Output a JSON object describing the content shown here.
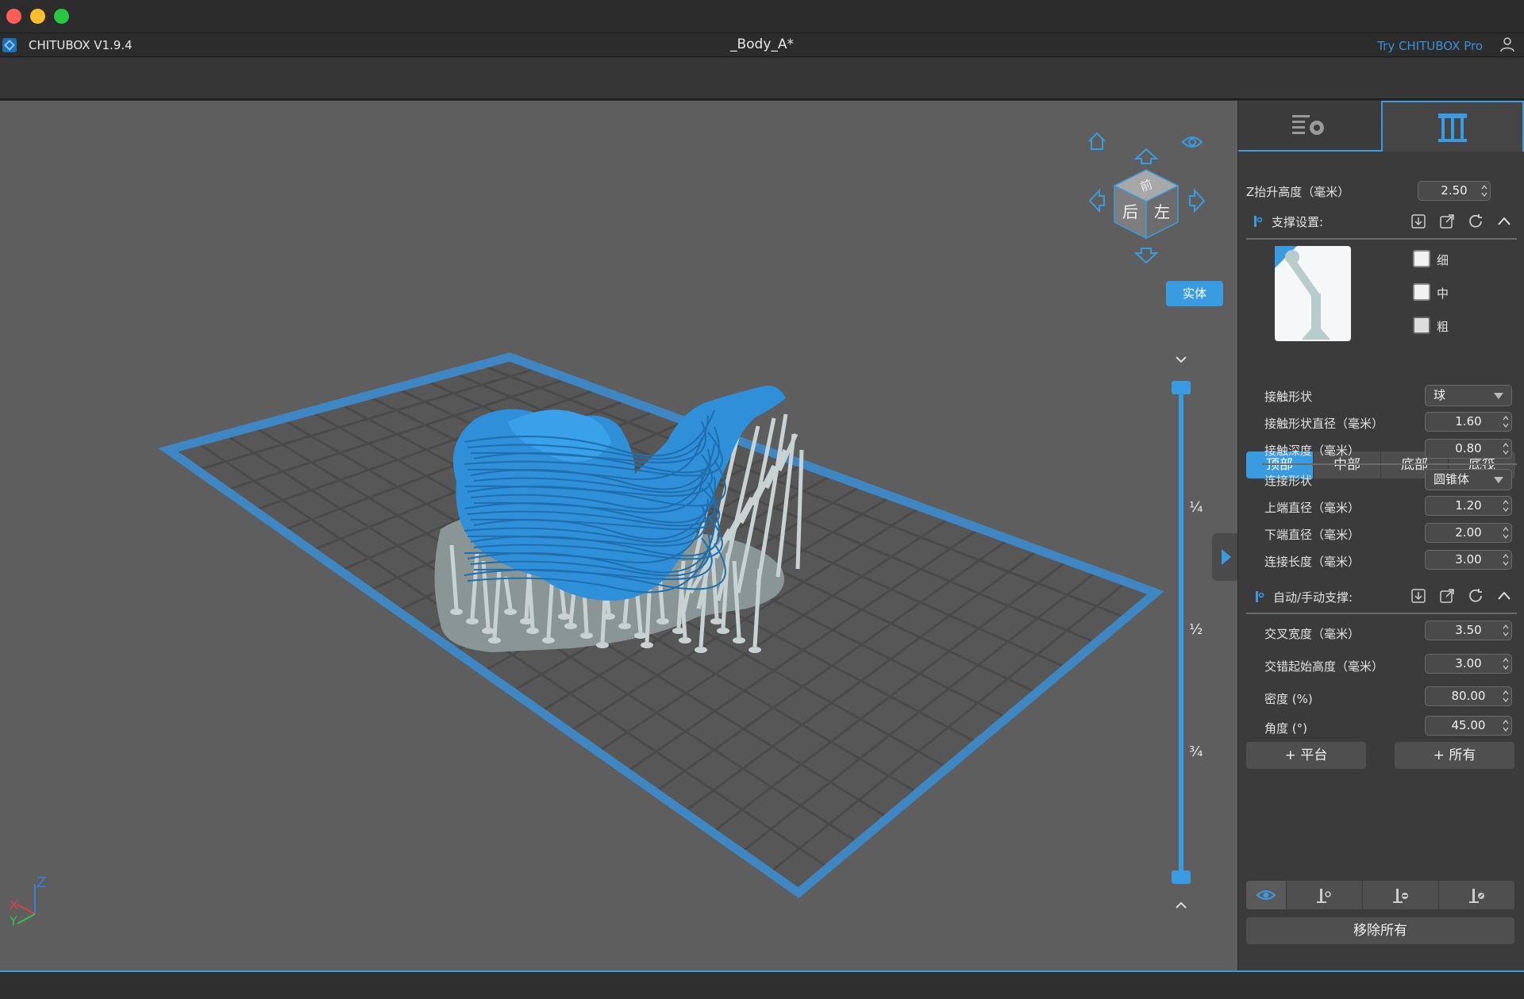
{
  "app": {
    "name": "CHITUBOX V1.9.4",
    "document_title": "_Body_A*",
    "try_pro": "Try CHITUBOX Pro"
  },
  "viewport": {
    "cube_faces": {
      "top": "前",
      "left": "后",
      "right": "左"
    },
    "render_mode_button": "实体",
    "slider_marks": [
      "¼",
      "½",
      "¾"
    ],
    "axes": {
      "x": "X",
      "y": "Y",
      "z": "Z"
    }
  },
  "panel": {
    "z_lift": {
      "label": "Z抬升高度（毫米）",
      "value": "2.50"
    },
    "support_settings": {
      "title": "支撑设置:",
      "density_options": [
        {
          "label": "细",
          "checked": false
        },
        {
          "label": "中",
          "checked": false
        },
        {
          "label": "粗",
          "checked": false
        }
      ],
      "tabs": [
        "顶部",
        "中部",
        "底部",
        "底筏"
      ],
      "active_tab": "顶部",
      "fields": {
        "contact_shape": {
          "label": "接触形状",
          "value": "球"
        },
        "contact_diameter": {
          "label": "接触形状直径（毫米）",
          "value": "1.60"
        },
        "contact_depth": {
          "label": "接触深度（毫米）",
          "value": "0.80"
        },
        "connection_shape": {
          "label": "连接形状",
          "value": "圆锥体"
        },
        "upper_diameter": {
          "label": "上端直径（毫米）",
          "value": "1.20"
        },
        "lower_diameter": {
          "label": "下端直径（毫米）",
          "value": "2.00"
        },
        "connection_length": {
          "label": "连接长度（毫米）",
          "value": "3.00"
        }
      }
    },
    "auto_support": {
      "title": "自动/手动支撑:",
      "fields": {
        "cross_width": {
          "label": "交叉宽度（毫米）",
          "value": "3.50"
        },
        "cross_start_height": {
          "label": "交错起始高度（毫米）",
          "value": "3.00"
        },
        "density": {
          "label": "密度 (%)",
          "value": "80.00"
        },
        "angle": {
          "label": "角度 (°)",
          "value": "45.00"
        }
      },
      "add_platform": "+ 平台",
      "add_all": "+ 所有",
      "remove_all": "移除所有"
    }
  },
  "colors": {
    "accent": "#3a9ce0",
    "model": "#2f8fd8",
    "supports": "#b8c4c4",
    "viewport_bg": "#5e5e5e",
    "panel_bg": "#3b3b3b"
  },
  "icons": [
    "home-icon",
    "eye-icon",
    "arrow-up-icon",
    "arrow-left-icon",
    "arrow-right-icon",
    "arrow-down-icon",
    "slice-settings-icon",
    "support-tab-icon",
    "import-icon",
    "export-icon",
    "refresh-icon",
    "collapse-icon",
    "user-icon"
  ]
}
